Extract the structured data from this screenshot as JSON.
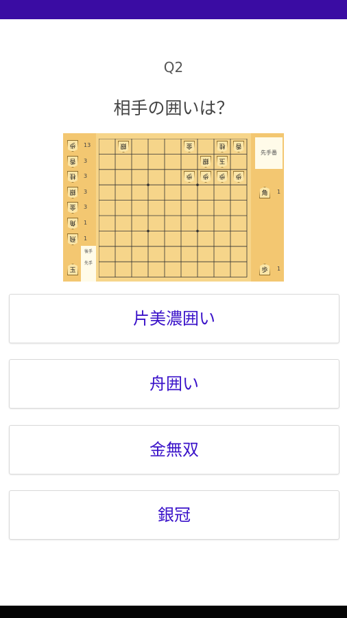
{
  "quiz": {
    "question_number": "Q2",
    "question": "相手の囲いは？"
  },
  "board": {
    "turn_label": "先手番",
    "kifu_label_1": "後手",
    "kifu_label_2": "先手",
    "opponent_hand": [
      {
        "piece": "歩",
        "count": "13"
      },
      {
        "piece": "香",
        "count": "3"
      },
      {
        "piece": "桂",
        "count": "3"
      },
      {
        "piece": "銀",
        "count": "3"
      },
      {
        "piece": "金",
        "count": "3"
      },
      {
        "piece": "角",
        "count": "1"
      },
      {
        "piece": "飛",
        "count": "1"
      }
    ],
    "opponent_king": "玉",
    "player_hand": [
      {
        "piece": "角",
        "count": "1"
      },
      {
        "piece": "歩",
        "count": "1"
      }
    ],
    "pieces": [
      {
        "file": 8,
        "rank": 1,
        "piece": "銀",
        "side": "gote"
      },
      {
        "file": 4,
        "rank": 1,
        "piece": "金",
        "side": "gote"
      },
      {
        "file": 2,
        "rank": 1,
        "piece": "桂",
        "side": "gote"
      },
      {
        "file": 1,
        "rank": 1,
        "piece": "香",
        "side": "gote"
      },
      {
        "file": 3,
        "rank": 2,
        "piece": "銀",
        "side": "gote"
      },
      {
        "file": 2,
        "rank": 2,
        "piece": "玉",
        "side": "gote"
      },
      {
        "file": 4,
        "rank": 3,
        "piece": "歩",
        "side": "gote"
      },
      {
        "file": 3,
        "rank": 3,
        "piece": "歩",
        "side": "gote"
      },
      {
        "file": 2,
        "rank": 3,
        "piece": "歩",
        "side": "gote"
      },
      {
        "file": 1,
        "rank": 3,
        "piece": "歩",
        "side": "gote"
      }
    ]
  },
  "answers": [
    "片美濃囲い",
    "舟囲い",
    "金無双",
    "銀冠"
  ],
  "colors": {
    "accent": "#3a0ca3",
    "answer_text": "#3a12c9",
    "board": "#f6d58a"
  }
}
